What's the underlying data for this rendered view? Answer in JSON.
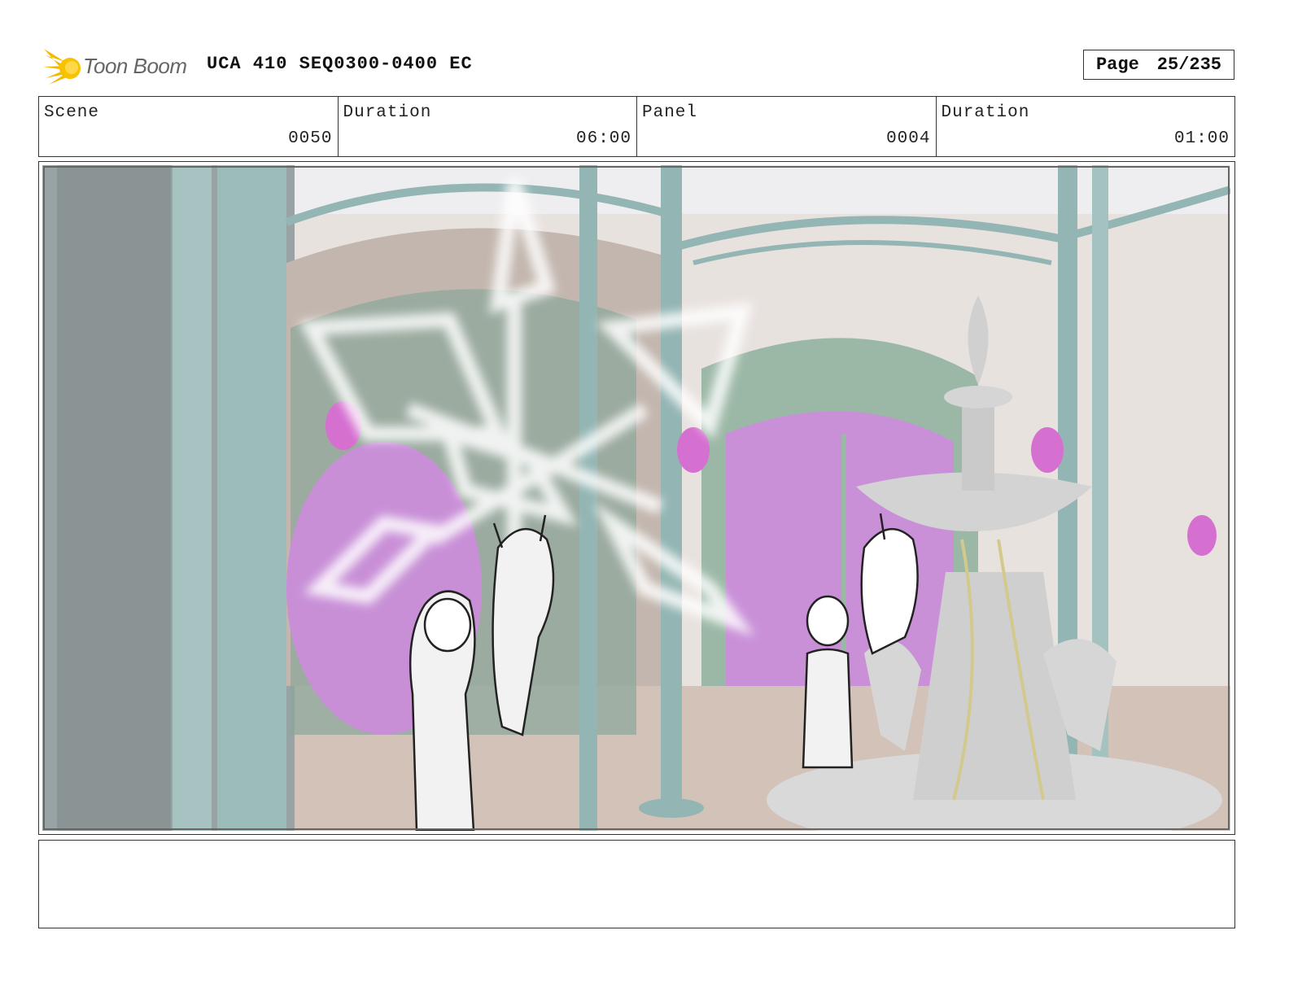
{
  "header": {
    "logo_text": "Toon Boom",
    "doc_title": "UCA 410 SEQ0300-0400 EC",
    "page_label": "Page",
    "page_number": "25/235"
  },
  "info": {
    "scene_label": "Scene",
    "scene_value": "0050",
    "scene_duration_label": "Duration",
    "scene_duration_value": "06:00",
    "panel_label": "Panel",
    "panel_value": "0004",
    "panel_duration_label": "Duration",
    "panel_duration_value": "01:00"
  },
  "notes": {
    "text": ""
  },
  "colors": {
    "logo_accent": "#f5b800",
    "teal_pillar": "#93b5b3",
    "magenta_window": "#c98fd8",
    "wall": "#e6dfdc"
  }
}
